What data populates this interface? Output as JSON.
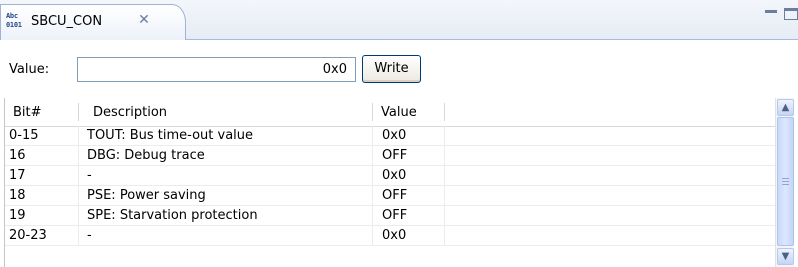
{
  "tab": {
    "icon_line1": "Abc",
    "icon_line2": "0101",
    "title": "SBCU_CON",
    "close_glyph": "✕"
  },
  "value_row": {
    "label": "Value:",
    "input_value": "0x0",
    "write_button": "Write"
  },
  "table": {
    "columns": [
      "Bit#",
      "Description",
      "Value"
    ],
    "rows": [
      {
        "bit": "0-15",
        "description": "TOUT: Bus time-out value",
        "value": "0x0"
      },
      {
        "bit": "16",
        "description": "DBG: Debug trace",
        "value": "OFF"
      },
      {
        "bit": "17",
        "description": "-",
        "value": "0x0"
      },
      {
        "bit": "18",
        "description": "PSE: Power saving",
        "value": "OFF"
      },
      {
        "bit": "19",
        "description": "SPE: Starvation protection",
        "value": "OFF"
      },
      {
        "bit": "20-23",
        "description": "-",
        "value": "0x0"
      }
    ]
  },
  "scrollbar": {
    "up_arrow": "▲",
    "down_arrow": "▼"
  },
  "colors": {
    "tab_border": "#9fb3d2",
    "scroll_thumb": "#c9d8fb",
    "button_border": "#003c74"
  }
}
